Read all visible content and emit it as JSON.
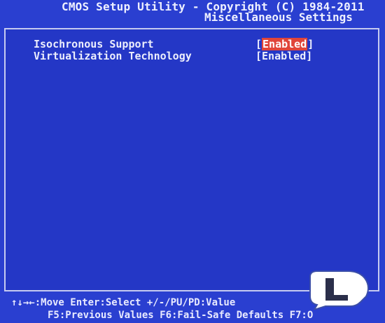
{
  "header": {
    "line1": "CMOS Setup Utility - Copyright (C) 1984-2011",
    "line2": "Miscellaneous Settings"
  },
  "options": [
    {
      "label": "Isochronous Support",
      "value_open": "[",
      "value": "Enabled",
      "value_close": "]",
      "selected": true
    },
    {
      "label": "Virtualization Technology",
      "value_open": "[",
      "value": "Enabled",
      "value_close": "]",
      "selected": false
    }
  ],
  "footer": {
    "line1": "↑↓→←:Move  Enter:Select  +/-/PU/PD:Value",
    "line2": "F5:Previous Values  F6:Fail-Safe Defaults  F7:O"
  },
  "colors": {
    "background": "#2a3fd0",
    "highlight": "#e0453a",
    "text": "#e4e6f8"
  },
  "logo": {
    "icon": "legit-reviews-logo",
    "letter": "L"
  }
}
